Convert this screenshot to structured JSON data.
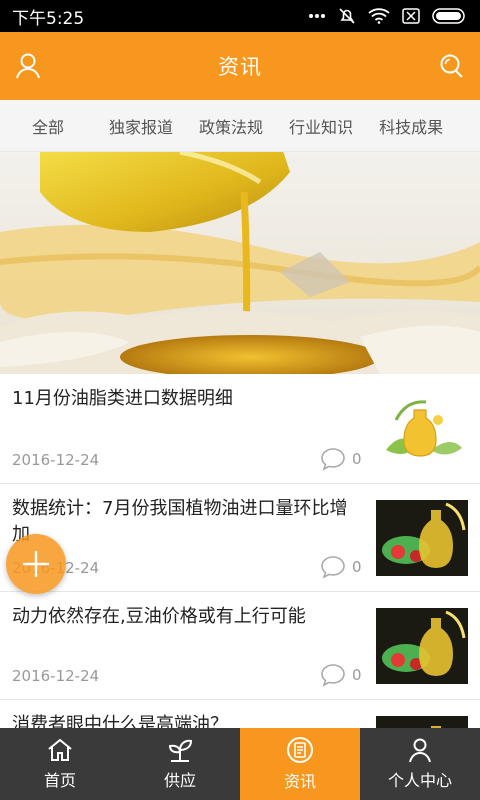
{
  "status": {
    "time": "下午5:25"
  },
  "header": {
    "title": "资讯",
    "left_icon": "user-icon",
    "right_icon": "search-icon",
    "color": "#f7971e"
  },
  "tabs": [
    "全部",
    "独家报道",
    "政策法规",
    "行业知识",
    "科技成果"
  ],
  "hero": {
    "image": "cooking-oil-pouring-onto-flour"
  },
  "news": [
    {
      "title": "11月份油脂类进口数据明细",
      "date": "2016-12-24",
      "comments": "0",
      "thumb": "oil-bottle-leaves"
    },
    {
      "title": "数据统计：7月份我国植物油进口量环比增加",
      "date": "2016-12-24",
      "comments": "0",
      "thumb": "oil-vegetables"
    },
    {
      "title": "动力依然存在,豆油价格或有上行可能",
      "date": "2016-12-24",
      "comments": "0",
      "thumb": "oil-vegetables"
    },
    {
      "title": "消费者眼中什么是高端油？",
      "date": "",
      "comments": "",
      "thumb": "oil-vegetables"
    }
  ],
  "fab": {
    "icon": "plus-icon"
  },
  "bottom_nav": [
    {
      "label": "首页",
      "icon": "home-icon"
    },
    {
      "label": "供应",
      "icon": "sprout-icon"
    },
    {
      "label": "资讯",
      "icon": "news-icon",
      "active": true
    },
    {
      "label": "个人中心",
      "icon": "user-icon"
    }
  ],
  "colors": {
    "accent": "#f7971e",
    "nav_bg": "#3a3a3a"
  }
}
